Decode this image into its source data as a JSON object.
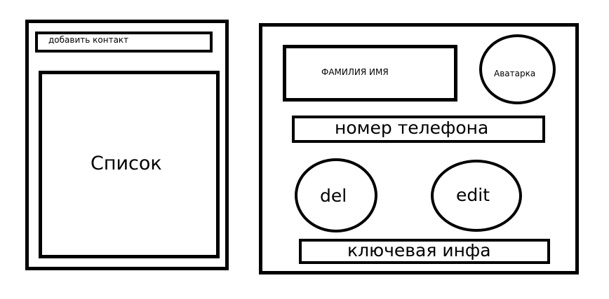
{
  "left_panel": {
    "add_contact_label": "добавить контакт",
    "list_label": "Список"
  },
  "right_panel": {
    "name_label": "ФАМИЛИЯ ИМЯ",
    "avatar_label": "Аватарка",
    "phone_label": "номер телефона",
    "del_label": "del",
    "edit_label": "edit",
    "key_info_label": "ключевая инфа"
  }
}
